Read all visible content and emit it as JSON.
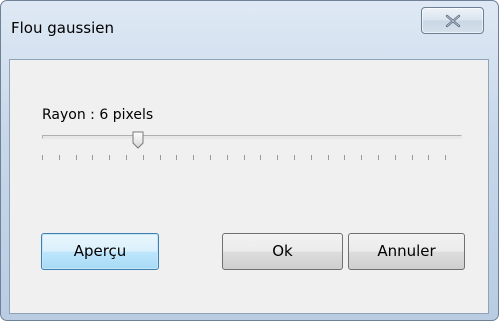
{
  "window": {
    "title": "Flou gaussien"
  },
  "icons": {
    "close": "close-icon"
  },
  "slider": {
    "label": "Rayon : 6 pixels",
    "value": 6,
    "tick_count": 26
  },
  "buttons": {
    "preview": "Aperçu",
    "ok": "Ok",
    "cancel": "Annuler"
  },
  "colors": {
    "frame": "#b9cce2",
    "default_button_border": "#3c7fb1"
  }
}
